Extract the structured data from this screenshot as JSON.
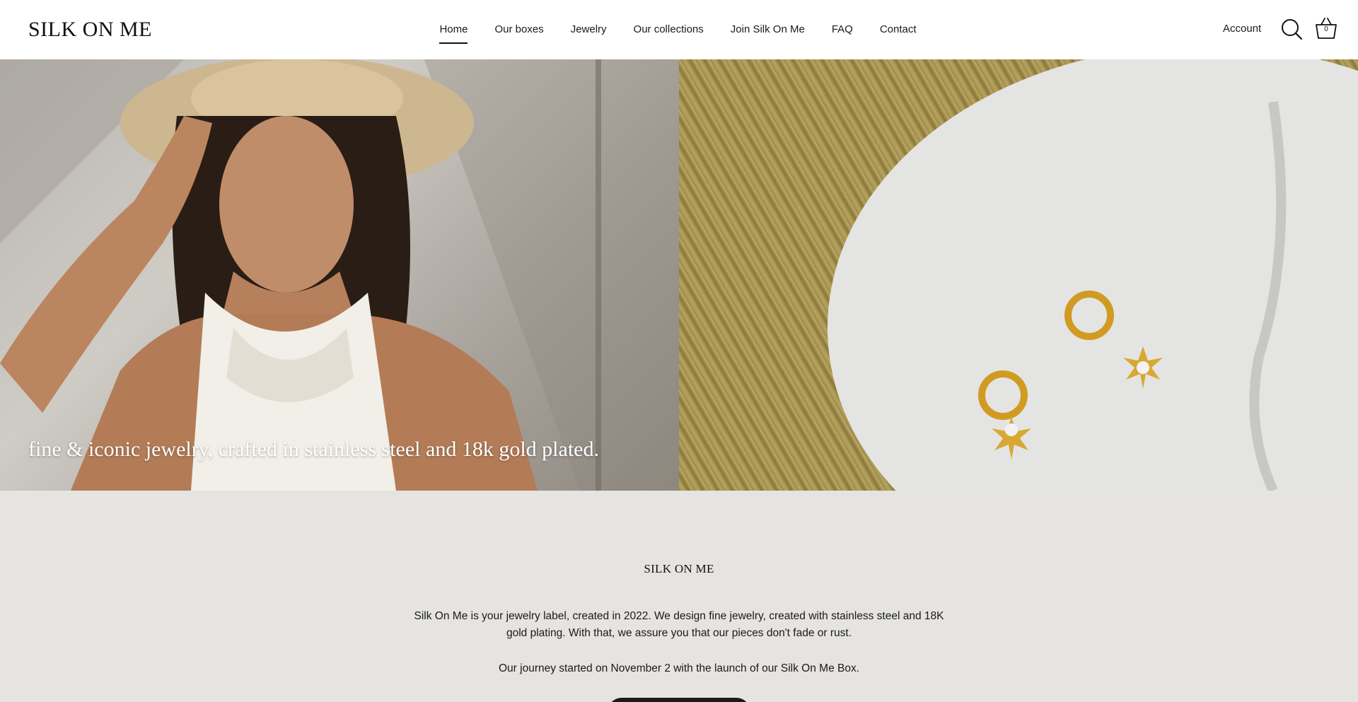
{
  "header": {
    "logo": "SILK ON ME",
    "nav": [
      {
        "label": "Home",
        "active": true
      },
      {
        "label": "Our boxes"
      },
      {
        "label": "Jewelry"
      },
      {
        "label": "Our collections"
      },
      {
        "label": "Join Silk On Me"
      },
      {
        "label": "FAQ"
      },
      {
        "label": "Contact"
      }
    ],
    "account_label": "Account",
    "cart_count": "0"
  },
  "hero": {
    "caption": "fine & iconic jewelry, crafted in stainless steel and 18k gold plated."
  },
  "about": {
    "logo": "SILK ON ME",
    "paragraph1": "Silk On Me is your jewelry label, created in 2022. We design fine jewelry, created with stainless steel and 18K gold plating. With that, we assure you that our pieces don't fade or rust.",
    "paragraph2": "Our journey started on November 2 with the launch of our Silk On Me Box."
  },
  "icons": {
    "search": "search-icon",
    "cart": "basket-icon"
  }
}
